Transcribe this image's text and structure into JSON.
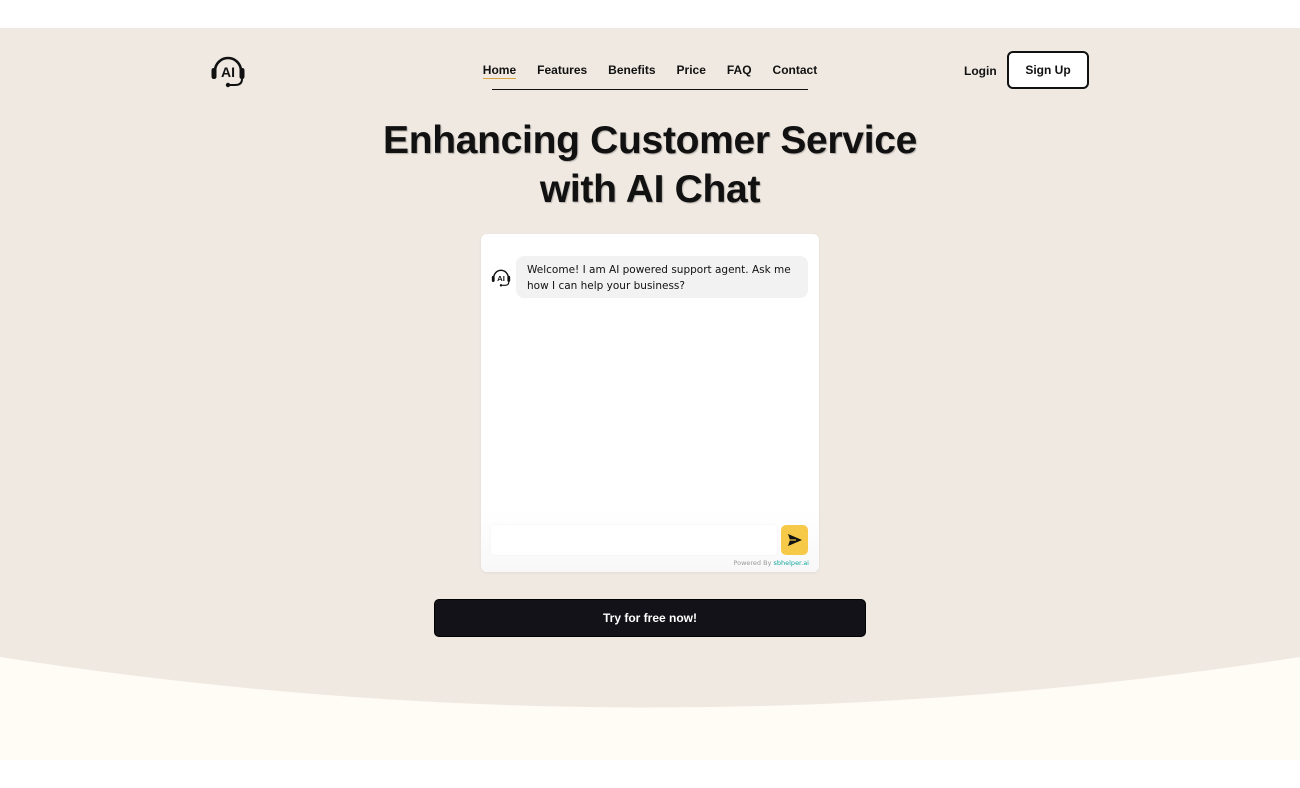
{
  "logo": {
    "text": "AI",
    "icon": "headset-icon"
  },
  "nav": {
    "items": [
      {
        "label": "Home",
        "active": true
      },
      {
        "label": "Features"
      },
      {
        "label": "Benefits"
      },
      {
        "label": "Price"
      },
      {
        "label": "FAQ"
      },
      {
        "label": "Contact"
      }
    ]
  },
  "auth": {
    "login_label": "Login",
    "signup_label": "Sign Up"
  },
  "hero": {
    "title_line1": "Enhancing Customer Service",
    "title_line2": "with AI Chat"
  },
  "chat": {
    "avatar_text": "AI",
    "welcome_message": "Welcome! I am AI powered support agent. Ask me how I can help your business?",
    "input_value": "",
    "input_placeholder": "",
    "send_icon": "send-icon",
    "powered_by_prefix": "Powered By",
    "powered_by_brand": "sbhelper.ai"
  },
  "cta": {
    "label": "Try for free now!"
  },
  "colors": {
    "hero_bg": "#f0e9e2",
    "wave_bg": "#fffcf5",
    "send_button": "#f7c948",
    "cta_bg": "#121218",
    "brand_accent": "#13a89e"
  }
}
